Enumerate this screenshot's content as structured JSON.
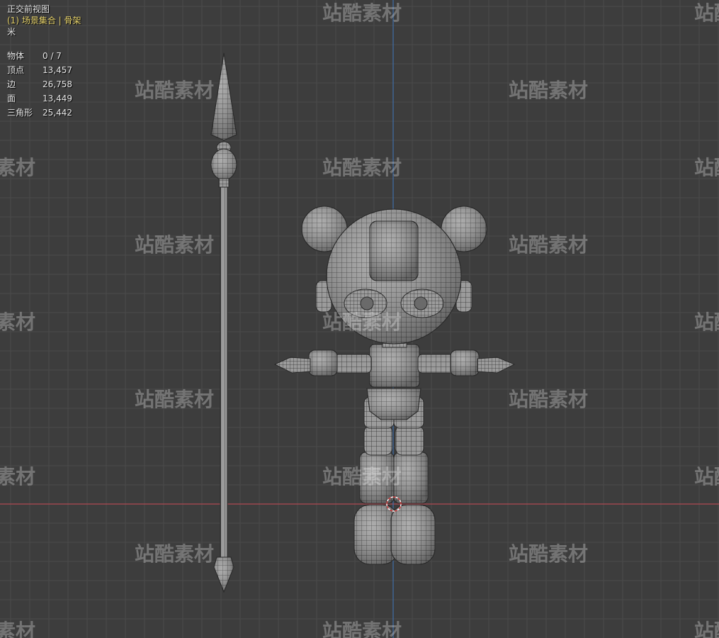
{
  "viewport": {
    "view_name": "正交前视图",
    "collection_label": "(1) 场景集合 | 骨架",
    "units": "米"
  },
  "stats": [
    {
      "label": "物体",
      "value": "0 / 7"
    },
    {
      "label": "顶点",
      "value": "13,457"
    },
    {
      "label": "边",
      "value": "26,758"
    },
    {
      "label": "面",
      "value": "13,449"
    },
    {
      "label": "三角形",
      "value": "25,442"
    }
  ],
  "watermark": "站酷素材",
  "colors": {
    "background": "#3d3d3d",
    "grid": "#4a4a4a",
    "x_axis": "#b04a52",
    "z_axis": "#3f6ea8",
    "mesh_fill": "#9a9a9a",
    "mesh_wire": "#2a2a2a",
    "label_yellow": "#e7d36b"
  }
}
